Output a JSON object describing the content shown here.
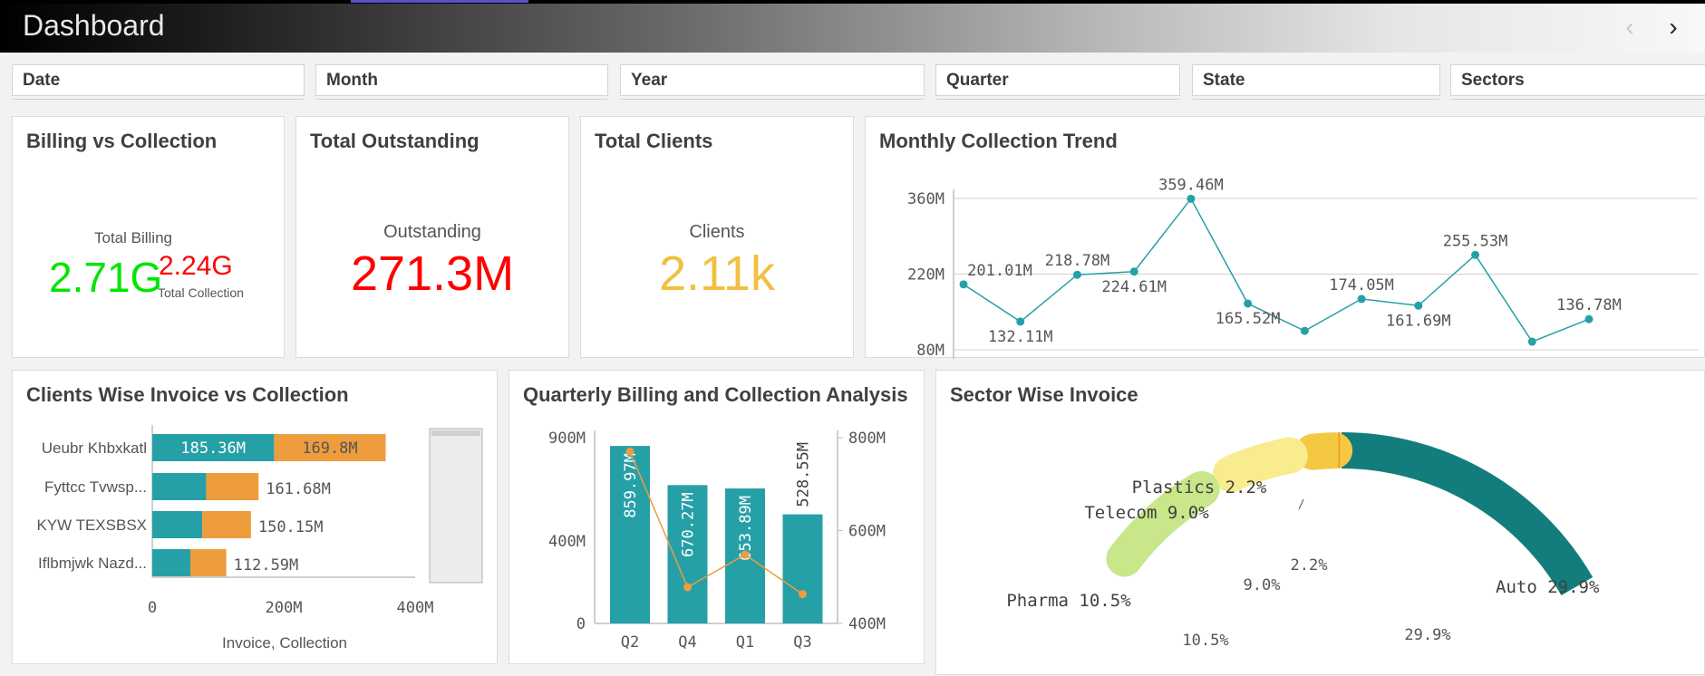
{
  "header": {
    "title": "Dashboard",
    "prev_icon": "chevron-left-icon",
    "next_icon": "chevron-right-icon"
  },
  "filters": [
    "Date",
    "Month",
    "Year",
    "Quarter",
    "State",
    "Sectors"
  ],
  "kpis": {
    "billing": {
      "title": "Billing vs Collection",
      "billing_label": "Total Billing",
      "billing_value": "2.71G",
      "collection_value": "2.24G",
      "collection_label": "Total Collection"
    },
    "outstanding": {
      "title": "Total Outstanding",
      "label": "Outstanding",
      "value": "271.3M"
    },
    "clients": {
      "title": "Total Clients",
      "label": "Clients",
      "value": "2.11k"
    }
  },
  "colors": {
    "teal": "#26a0a7",
    "orange": "#ed9c3e",
    "dark_teal": "#137d7d",
    "green": "#00e600",
    "red": "#ff0000",
    "gold": "#f0c040"
  },
  "chart_data": [
    {
      "id": "monthly",
      "type": "line",
      "title": "Monthly Collection Trend",
      "y_ticks": [
        "360M",
        "220M",
        "80M"
      ],
      "ylim": [
        80,
        360
      ],
      "values": [
        201.01,
        132.11,
        218.78,
        224.61,
        359.46,
        165.52,
        115,
        174.05,
        161.69,
        255.53,
        95,
        136.78
      ],
      "labels": [
        "201.01M",
        "132.11M",
        "218.78M",
        "224.61M",
        "359.46M",
        "165.52M",
        "",
        "174.05M",
        "161.69M",
        "255.53M",
        "",
        "136.78M"
      ],
      "grid": true
    },
    {
      "id": "clients",
      "type": "bar",
      "stacked": true,
      "orientation": "horizontal",
      "title": "Clients Wise Invoice vs Collection",
      "categories": [
        "Ueubr Khbxkatl",
        "Fyttcc Tvwsp...",
        "KYW TEXSBSX",
        "Iflbmjwk Nazd..."
      ],
      "series": [
        {
          "values": [
            185.36,
            82,
            76,
            58
          ]
        },
        {
          "values": [
            169.8,
            79.68,
            74.15,
            54.59
          ]
        }
      ],
      "segment_labels": [
        [
          "185.36M",
          "169.8M"
        ],
        [
          "",
          ""
        ],
        [
          "",
          ""
        ],
        [
          "",
          ""
        ]
      ],
      "total_labels": [
        "",
        "161.68M",
        "150.15M",
        "112.59M"
      ],
      "x_ticks": [
        "0",
        "200M",
        "400M"
      ],
      "xlim": [
        0,
        400
      ],
      "xlabel": "Invoice, Collection"
    },
    {
      "id": "quarterly",
      "type": "bar",
      "title": "Quarterly Billing and Collection Analysis",
      "categories": [
        "Q2",
        "Q4",
        "Q1",
        "Q3"
      ],
      "bar_values": [
        859.97,
        670.27,
        653.89,
        528.55
      ],
      "bar_labels": [
        "859.97M",
        "670.27M",
        "653.89M",
        "528.55M"
      ],
      "line_values": [
        770,
        478,
        548,
        463
      ],
      "y_left_ticks": [
        "900M",
        "400M",
        "0"
      ],
      "ylim_left": [
        0,
        900
      ],
      "y_right_ticks": [
        "800M",
        "600M",
        "400M"
      ],
      "ylim_right": [
        400,
        800
      ]
    },
    {
      "id": "sector",
      "type": "pie",
      "title": "Sector Wise Invoice",
      "legend_title": "Sectors",
      "slices": [
        {
          "name": "Auto",
          "value": 29.9,
          "outer": "Auto 29.9%",
          "inner": "29.9%",
          "color": "#137d7d"
        },
        {
          "name": "Plastics",
          "value": 2.2,
          "outer": "Plastics 2.2%",
          "inner": "2.2%",
          "color": "#f5c842"
        },
        {
          "name": "Telecom",
          "value": 9.0,
          "outer": "Telecom 9.0%",
          "inner": "9.0%",
          "color": "#f8ec8e"
        },
        {
          "name": "Pharma",
          "value": 10.5,
          "outer": "Pharma 10.5%",
          "inner": "10.5%",
          "color": "#c8e68a"
        }
      ]
    }
  ]
}
